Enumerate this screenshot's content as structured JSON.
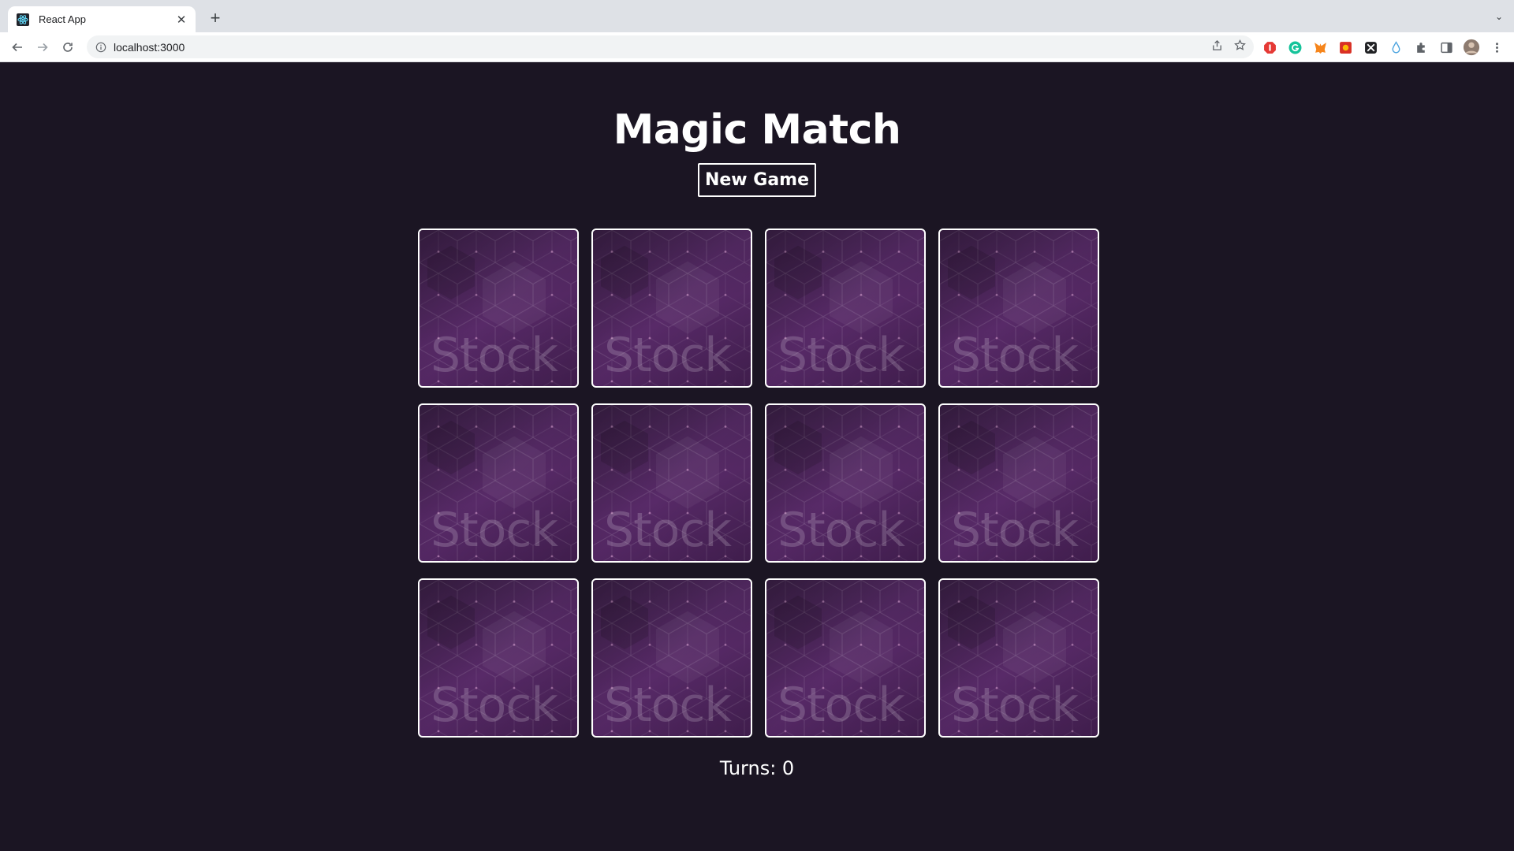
{
  "browser": {
    "tab_title": "React App",
    "url": "localhost:3000",
    "extensions": [
      {
        "name": "adblock-icon",
        "color": "#e53935"
      },
      {
        "name": "grammarly-icon",
        "color": "#15c39a"
      },
      {
        "name": "metamask-icon",
        "color": "#f6851b"
      },
      {
        "name": "extension-red-icon",
        "color": "#d93025"
      },
      {
        "name": "extension-dark-icon",
        "color": "#202124"
      },
      {
        "name": "extension-drop-icon",
        "color": "#4aa3df"
      }
    ]
  },
  "game": {
    "title": "Magic Match",
    "new_game_label": "New Game",
    "turns_label": "Turns: 0",
    "card_back_text": "Stock",
    "card_count": 12,
    "colors": {
      "background": "#1b1523",
      "card_purple": "#582a68",
      "text": "#ffffff"
    }
  }
}
